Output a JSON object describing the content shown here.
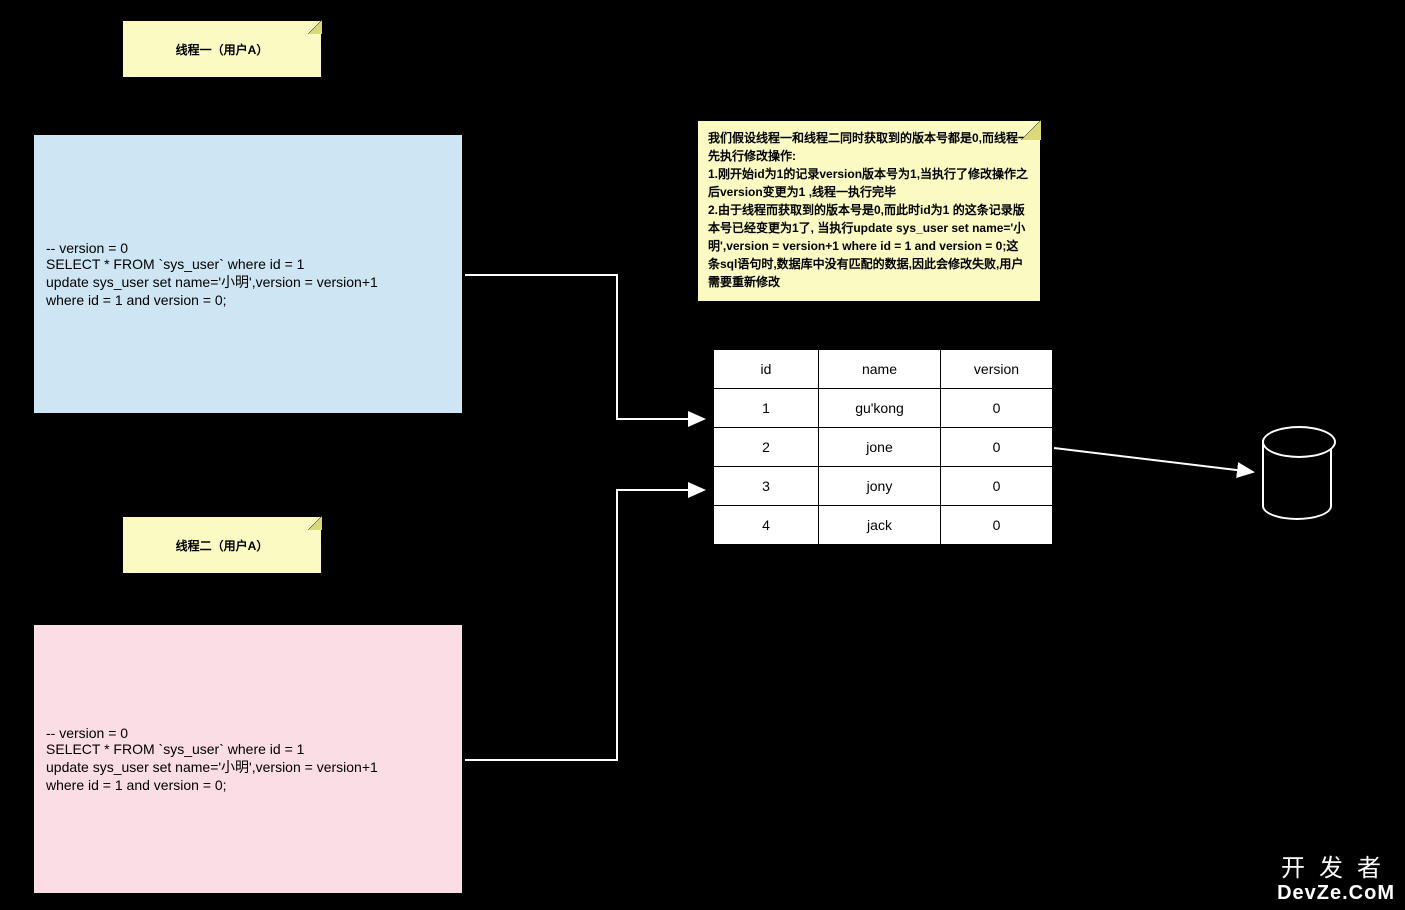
{
  "thread1": {
    "title": "线程一（用户A）",
    "code": "-- version = 0\nSELECT * FROM `sys_user` where id = 1\nupdate sys_user set name='小明',version = version+1\n where id = 1 and version = 0;"
  },
  "thread2": {
    "title": "线程二（用户A）",
    "code": "-- version = 0\nSELECT * FROM `sys_user` where id = 1\nupdate sys_user set name='小明',version = version+1\n where id = 1 and version = 0;"
  },
  "explanation": "我们假设线程一和线程二同时获取到的版本号都是0,而线程一先执行修改操作:\n1.刚开始id为1的记录version版本号为1,当执行了修改操作之后version变更为1 ,线程一执行完毕\n2.由于线程而获取到的版本号是0,而此时id为1 的这条记录版本号已经变更为1了, 当执行update sys_user set name='小明',version = version+1   where id = 1 and version = 0;这条sql语句时,数据库中没有匹配的数据,因此会修改失败,用户需要重新修改",
  "table": {
    "headers": {
      "id": "id",
      "name": "name",
      "version": "version"
    },
    "rows": [
      {
        "id": "1",
        "name": "gu'kong",
        "version": "0"
      },
      {
        "id": "2",
        "name": "jone",
        "version": "0"
      },
      {
        "id": "3",
        "name": "jony",
        "version": "0"
      },
      {
        "id": "4",
        "name": "jack",
        "version": "0"
      }
    ]
  },
  "watermark": {
    "line1": "开发者",
    "line2": "DevZe.CoM"
  }
}
